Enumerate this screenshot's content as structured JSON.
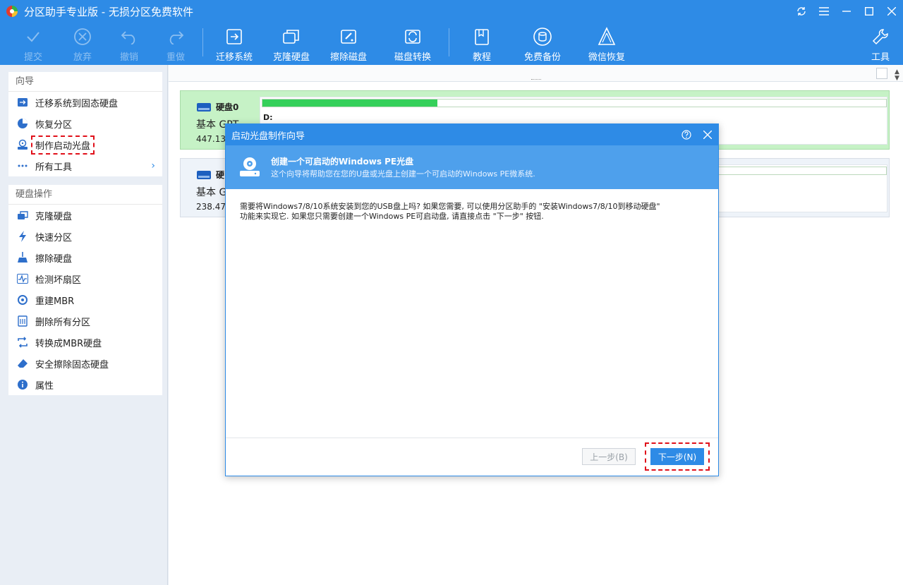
{
  "app": {
    "title": "分区助手专业版 - 无损分区免费软件"
  },
  "toolbar": {
    "items": [
      {
        "label": "提交",
        "icon": "check-icon",
        "enabled": false
      },
      {
        "label": "放弃",
        "icon": "cancel-circle-icon",
        "enabled": false
      },
      {
        "label": "撤销",
        "icon": "undo-icon",
        "enabled": false
      },
      {
        "label": "重做",
        "icon": "redo-icon",
        "enabled": false
      },
      {
        "label": "迁移系统",
        "icon": "migrate-os-icon",
        "enabled": true
      },
      {
        "label": "克隆硬盘",
        "icon": "clone-disk-icon",
        "enabled": true
      },
      {
        "label": "擦除磁盘",
        "icon": "wipe-disk-icon",
        "enabled": true
      },
      {
        "label": "磁盘转换",
        "icon": "disk-convert-icon",
        "enabled": true
      },
      {
        "label": "教程",
        "icon": "book-icon",
        "enabled": true
      },
      {
        "label": "免费备份",
        "icon": "backup-icon",
        "enabled": true
      },
      {
        "label": "微信恢复",
        "icon": "recover-icon",
        "enabled": true
      },
      {
        "label": "工具",
        "icon": "tools-icon",
        "enabled": true
      }
    ]
  },
  "sidebar": {
    "wizard": {
      "header": "向导",
      "items": [
        {
          "label": "迁移系统到固态硬盘",
          "icon": "migrate-icon"
        },
        {
          "label": "恢复分区",
          "icon": "recover-partition-icon"
        },
        {
          "label": "制作启动光盘",
          "icon": "bootable-disc-icon",
          "highlighted": true
        },
        {
          "label": "所有工具",
          "icon": "dots-icon",
          "has_arrow": true
        }
      ]
    },
    "disk_ops": {
      "header": "硬盘操作",
      "items": [
        {
          "label": "克隆硬盘",
          "icon": "clone-icon"
        },
        {
          "label": "快速分区",
          "icon": "lightning-icon"
        },
        {
          "label": "擦除硬盘",
          "icon": "broom-icon"
        },
        {
          "label": "检测坏扇区",
          "icon": "pulse-icon"
        },
        {
          "label": "重建MBR",
          "icon": "rebuild-icon"
        },
        {
          "label": "删除所有分区",
          "icon": "delete-icon"
        },
        {
          "label": "转换成MBR硬盘",
          "icon": "convert-icon"
        },
        {
          "label": "安全擦除固态硬盘",
          "icon": "eraser-icon"
        },
        {
          "label": "属性",
          "icon": "info-icon"
        }
      ]
    }
  },
  "disks": [
    {
      "name": "硬盘0",
      "type": "基本 GPT",
      "size": "447.13G",
      "partition_label": "D:",
      "used_fraction": 0.28,
      "selected": true
    },
    {
      "name": "硬",
      "type": "基本 G",
      "size": "238.47",
      "partition_label": "",
      "used_fraction": 0,
      "selected": false
    }
  ],
  "dialog": {
    "title": "启动光盘制作向导",
    "banner_title": "创建一个可启动的Windows PE光盘",
    "banner_subtitle": "这个向导将帮助您在您的U盘或光盘上创建一个可启动的Windows PE微系统.",
    "body_line1": "需要将Windows7/8/10系统安装到您的USB盘上吗? 如果您需要, 可以使用分区助手的 \"安装Windows7/8/10到移动硬盘\"",
    "body_line2": "功能来实现它. 如果您只需要创建一个Windows PE可启动盘, 请直接点击 \"下一步\" 按钮.",
    "prev_label": "上一步(B)",
    "next_label": "下一步(N)"
  },
  "colors": {
    "accent": "#2e8be6",
    "banner": "#4ea0ec",
    "selected_disk": "#c6f2c6",
    "used_bar": "#35d05a",
    "highlight_dash": "#e0101a"
  }
}
